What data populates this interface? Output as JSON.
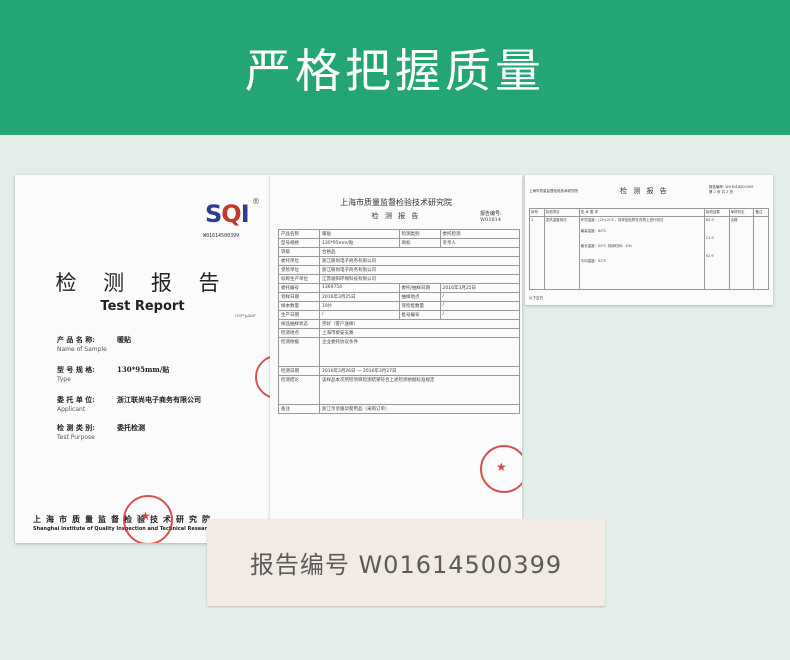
{
  "banner": {
    "title": "严格把握质量"
  },
  "cover": {
    "logo_reg": "®",
    "logo_code": "W01614500399",
    "title_cn": "检 测 报 告",
    "title_en": "Test Report",
    "tag": "INF*pAhF",
    "fields": [
      {
        "label": "产 品 名 称:",
        "value": "暖贴",
        "en": "Name of Sample"
      },
      {
        "label": "型 号 规 格:",
        "value": "130*95mm/贴",
        "en": "Type"
      },
      {
        "label": "委 托 单 位:",
        "value": "浙江联尚电子商务有限公司",
        "en": "Applicant"
      },
      {
        "label": "检 测 类 别:",
        "value": "委托检测",
        "en": "Test Purpose"
      }
    ],
    "institute_cn": "上海市质量监督检验技术研究院",
    "institute_en": "Shanghai Institute of Quality Inspection and Technical Research"
  },
  "form": {
    "heading": "上海市质量监督检验技术研究院",
    "subheading": "检 测 报 告",
    "report_no": "报告编号: W01614",
    "rows": [
      [
        "产品名称",
        "暖贴",
        "检测类别",
        "委托检测"
      ],
      [
        "型号规格",
        "130*95mm/贴",
        "商标",
        "亲亲人"
      ],
      [
        "等级",
        "合格品",
        "",
        ""
      ],
      [
        "委托单位",
        "浙江联尚电子商务有限公司",
        "",
        ""
      ],
      [
        "受检单位",
        "浙江联尚电子商务有限公司",
        "",
        ""
      ],
      [
        "标称生产单位",
        "江苏骄阳环保科技有限公司",
        "",
        ""
      ],
      [
        "委托编号",
        "1369754",
        "委托/抽样日期",
        "2016年3月25日"
      ],
      [
        "到样日期",
        "2016年3月25日",
        "抽样地点",
        "/"
      ],
      [
        "样本数量",
        "10片",
        "受检批数量",
        "/"
      ],
      [
        "生产日期",
        "/",
        "批号编号",
        "/"
      ],
      [
        "样品抽样状态",
        "完好（客户送样）",
        "",
        ""
      ],
      [
        "检测地点",
        "上海市黎安支路",
        "",
        ""
      ],
      [
        "检测依据",
        "企业委托协议条件",
        "",
        ""
      ],
      [
        "检测日期",
        "2016年3月26日 — 2016年3月27日",
        "",
        ""
      ],
      [
        "检测结论",
        "该样品本次所检项目检测结果符合上述检测依据标准规定",
        "",
        ""
      ],
      [
        "备注",
        "浙江亲亲娘孕婴用品（采购订单）",
        "",
        ""
      ]
    ]
  },
  "table": {
    "left_header": "上海市质量监督检验技术研究院",
    "title": "检 测 报 告",
    "right_header": "报告编号: W01614500399",
    "page": "第 2 页 共 3 页",
    "columns": [
      "序号",
      "检测项目",
      "技 术 要 求",
      "检测结果",
      "单项判定",
      "备注"
    ],
    "row": {
      "index": "1",
      "item": "发热温度测试",
      "requirement": "环境温度：(25±2)℃，将样品贴附在衣物上进行测试",
      "results": [
        "最高温度：60℃",
        "最长温度：00℃ 持续时间：10h",
        "平均温度：52℃"
      ],
      "values": [
        "65.9",
        "11.9",
        "52.9"
      ],
      "judgement": "合格"
    },
    "footer": "以下空白"
  },
  "label": {
    "text": "报告编号 W01614500399"
  }
}
